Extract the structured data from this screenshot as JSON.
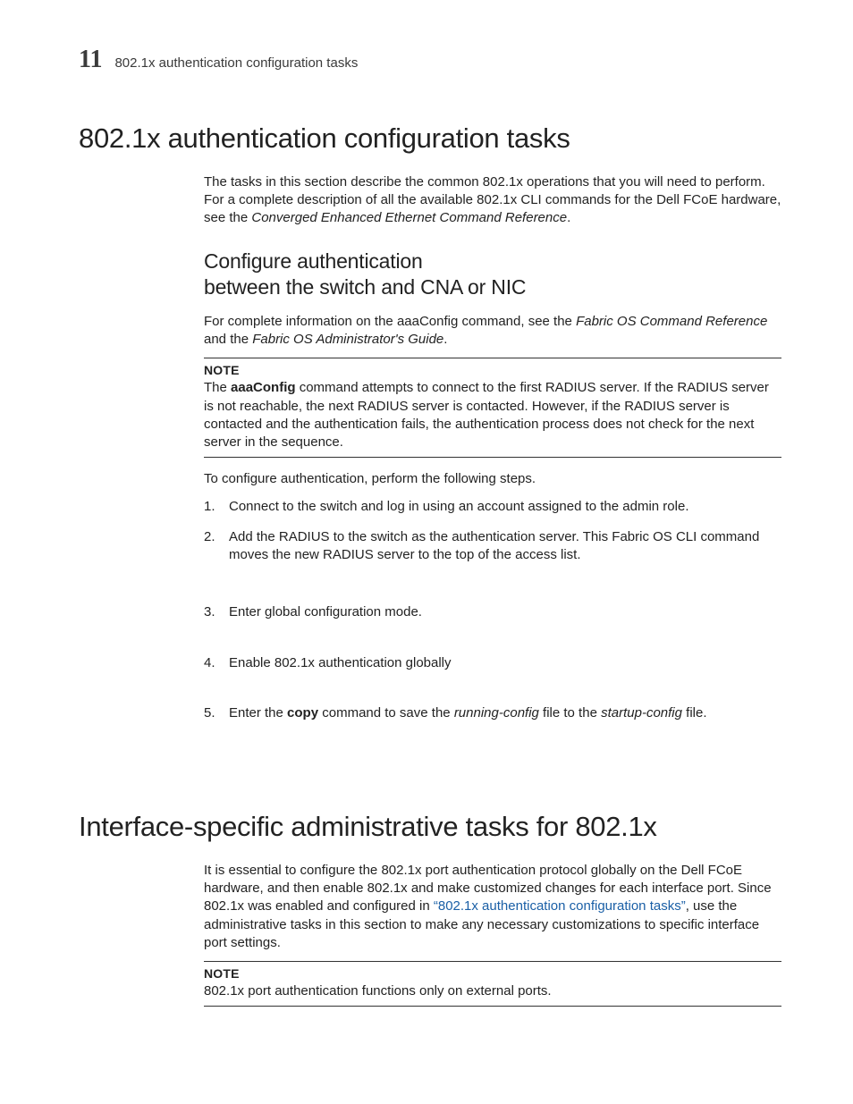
{
  "header": {
    "chapter_number": "11",
    "running_title": "802.1x authentication configuration tasks"
  },
  "section1": {
    "title": "802.1x authentication configuration tasks",
    "intro_pre": "The tasks in this section describe the common 802.1x operations that you will need to perform. For a complete description of all the available 802.1x CLI commands for the Dell FCoE hardware, see the ",
    "intro_italic": "Converged Enhanced Ethernet Command Reference",
    "intro_post": ".",
    "sub_title_line1": "Configure authentication",
    "sub_title_line2": "between the switch and CNA or NIC",
    "sub_intro_pre": "For complete information on the aaaConfig command, see the ",
    "sub_intro_it1": "Fabric OS Command Reference",
    "sub_intro_mid": " and the ",
    "sub_intro_it2": "Fabric OS Administrator's Guide",
    "sub_intro_post": ".",
    "note_label": "NOTE",
    "note_pre": "The ",
    "note_bold": "aaaConfig",
    "note_post": " command attempts to connect to the first RADIUS server. If the RADIUS server is not reachable, the next RADIUS server is contacted. However, if the RADIUS server is contacted and the authentication fails, the authentication process does not check for the next server in the sequence.",
    "steps_lead": "To configure authentication, perform the following steps.",
    "steps": {
      "s1": "Connect to the switch and log in using an account assigned to the admin role.",
      "s2": "Add the RADIUS to the switch as the authentication server. This Fabric OS CLI command moves the new RADIUS server to the top of the access list.",
      "s3": "Enter global configuration mode.",
      "s4": "Enable 802.1x authentication globally",
      "s5_pre": "Enter the ",
      "s5_bold": "copy",
      "s5_mid": " command to save the ",
      "s5_it1": "running-config",
      "s5_mid2": " file to the ",
      "s5_it2": "startup-config",
      "s5_post": " file."
    }
  },
  "section2": {
    "title": "Interface-specific administrative tasks for 802.1x",
    "intro_pre": "It is essential to configure the 802.1x port authentication protocol globally on the Dell FCoE hardware, and then enable 802.1x and make customized changes for each interface port. Since 802.1x was enabled and configured in ",
    "intro_link": "“802.1x authentication configuration tasks”",
    "intro_post": ", use the administrative tasks in this section to make any necessary customizations to specific interface port settings.",
    "note_label": "NOTE",
    "note_text": "802.1x port authentication functions only on external ports."
  }
}
